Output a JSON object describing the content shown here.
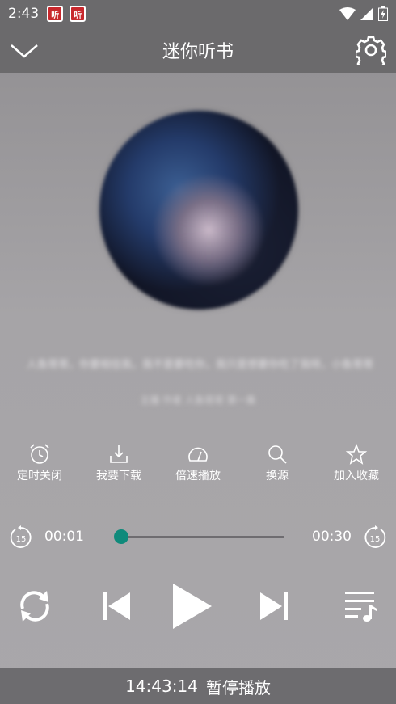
{
  "status_bar": {
    "time": "2:43",
    "notif_label": "听"
  },
  "header": {
    "title": "迷你听书",
    "back_icon": "chevron-down-icon",
    "settings_icon": "gear-icon"
  },
  "now_playing": {
    "title": "人鱼哥哥，你要相信我，我不是要吃你，我只是想要你吃了我呀，小鱼哥哥",
    "subtitle": "主播 作者 人鱼哥哥 第一集"
  },
  "actions": [
    {
      "label": "定时关闭",
      "icon": "alarm-clock-icon"
    },
    {
      "label": "我要下载",
      "icon": "download-icon"
    },
    {
      "label": "倍速播放",
      "icon": "speedometer-icon"
    },
    {
      "label": "换源",
      "icon": "search-icon"
    },
    {
      "label": "加入收藏",
      "icon": "star-icon"
    }
  ],
  "progress": {
    "current": "00:01",
    "total": "00:30",
    "fraction": 0.03,
    "skip_seconds": "15"
  },
  "controls": {
    "repeat_icon": "repeat-icon",
    "prev_icon": "skip-previous-icon",
    "play_icon": "play-icon",
    "next_icon": "skip-next-icon",
    "playlist_icon": "playlist-music-icon"
  },
  "footer": {
    "time": "14:43:14",
    "status": "暂停播放"
  },
  "colors": {
    "accent": "#0f8a7b",
    "bar": "#6b6a6c"
  }
}
